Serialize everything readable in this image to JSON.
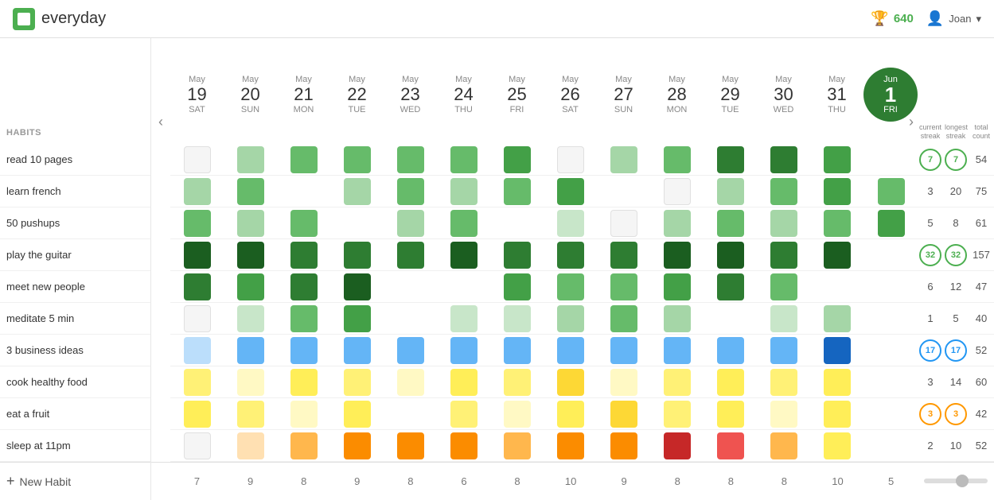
{
  "header": {
    "logo_text": "everyday",
    "score": "640",
    "user": "Joan"
  },
  "columns": [
    {
      "month": "May",
      "day": "19",
      "weekday": "SAT"
    },
    {
      "month": "May",
      "day": "20",
      "weekday": "SUN"
    },
    {
      "month": "May",
      "day": "21",
      "weekday": "MON"
    },
    {
      "month": "May",
      "day": "22",
      "weekday": "TUE"
    },
    {
      "month": "May",
      "day": "23",
      "weekday": "WED"
    },
    {
      "month": "May",
      "day": "24",
      "weekday": "THU"
    },
    {
      "month": "May",
      "day": "25",
      "weekday": "FRI"
    },
    {
      "month": "May",
      "day": "26",
      "weekday": "SAT"
    },
    {
      "month": "May",
      "day": "27",
      "weekday": "SUN"
    },
    {
      "month": "May",
      "day": "28",
      "weekday": "MON"
    },
    {
      "month": "May",
      "day": "29",
      "weekday": "TUE"
    },
    {
      "month": "May",
      "day": "30",
      "weekday": "WED"
    },
    {
      "month": "May",
      "day": "31",
      "weekday": "THU"
    },
    {
      "month": "Jun",
      "day": "1",
      "weekday": "FRI",
      "today": true
    }
  ],
  "habits_label": "HABITS",
  "habits": [
    {
      "name": "read 10 pages",
      "current_streak": "7",
      "longest_streak": "7",
      "total": "54",
      "streak_color": "green"
    },
    {
      "name": "learn french",
      "current_streak": "3",
      "longest_streak": "20",
      "total": "75",
      "streak_color": "none"
    },
    {
      "name": "50 pushups",
      "current_streak": "5",
      "longest_streak": "8",
      "total": "61",
      "streak_color": "none"
    },
    {
      "name": "play the guitar",
      "current_streak": "32",
      "longest_streak": "32",
      "total": "157",
      "streak_color": "green"
    },
    {
      "name": "meet new people",
      "current_streak": "6",
      "longest_streak": "12",
      "total": "47",
      "streak_color": "none"
    },
    {
      "name": "meditate 5 min",
      "current_streak": "1",
      "longest_streak": "5",
      "total": "40",
      "streak_color": "none"
    },
    {
      "name": "3 business ideas",
      "current_streak": "17",
      "longest_streak": "17",
      "total": "52",
      "streak_color": "blue"
    },
    {
      "name": "cook healthy food",
      "current_streak": "3",
      "longest_streak": "14",
      "total": "60",
      "streak_color": "none"
    },
    {
      "name": "eat a fruit",
      "current_streak": "3",
      "longest_streak": "3",
      "total": "42",
      "streak_color": "orange"
    },
    {
      "name": "sleep at 11pm",
      "current_streak": "2",
      "longest_streak": "10",
      "total": "52",
      "streak_color": "none"
    }
  ],
  "stats_headers": [
    "current streak",
    "longest streak",
    "total count"
  ],
  "footer_counts": [
    "7",
    "9",
    "8",
    "9",
    "8",
    "6",
    "8",
    "10",
    "9",
    "8",
    "8",
    "8",
    "10",
    "5"
  ],
  "new_habit_label": "+ New Habit"
}
